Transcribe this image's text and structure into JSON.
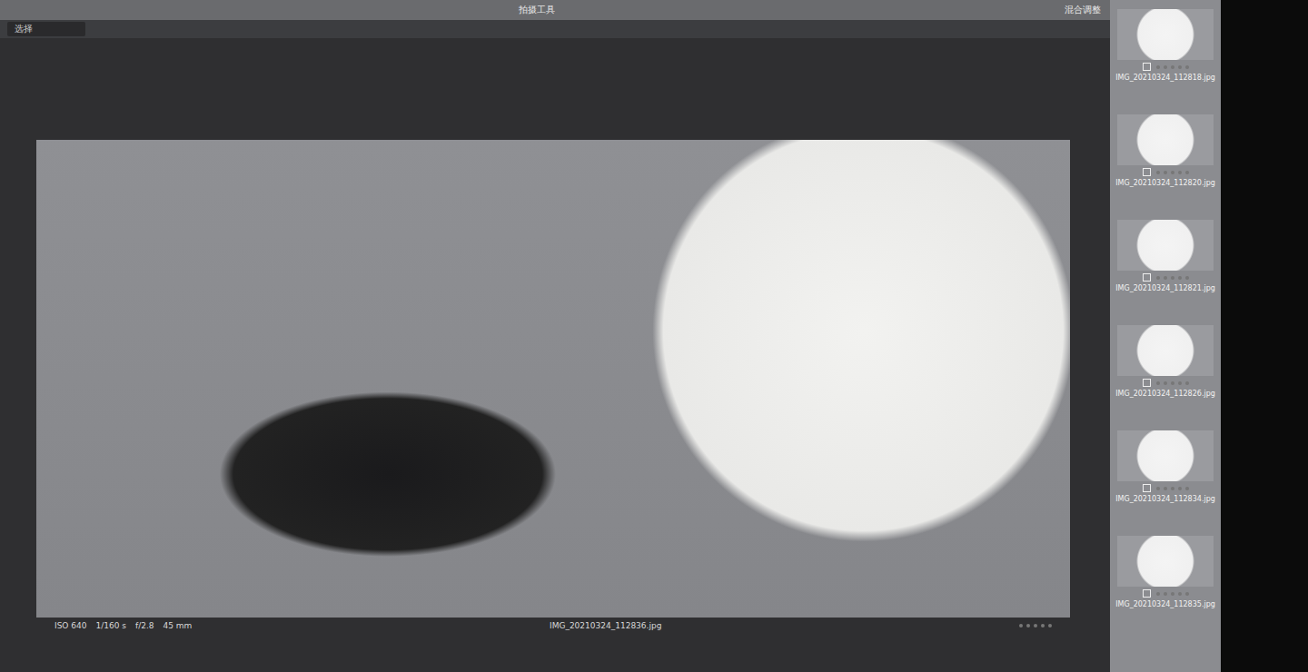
{
  "toolbar": {
    "title": "拍摄工具",
    "mode": "混合调整",
    "field": "选择"
  },
  "viewer": {
    "filename": "IMG_20210324_112836.jpg",
    "info": [
      "ISO 640",
      "1/160 s",
      "f/2.8",
      "45 mm"
    ],
    "stars": 0
  },
  "filmstrip": {
    "items": [
      {
        "filename": "IMG_20210324_112818.jpg",
        "stars": 0,
        "selected": false
      },
      {
        "filename": "IMG_20210324_112820.jpg",
        "stars": 0,
        "selected": false
      },
      {
        "filename": "IMG_20210324_112821.jpg",
        "stars": 0,
        "selected": false
      },
      {
        "filename": "IMG_20210324_112826.jpg",
        "stars": 0,
        "selected": false
      },
      {
        "filename": "IMG_20210324_112834.jpg",
        "stars": 0,
        "selected": false
      },
      {
        "filename": "IMG_20210324_112835.jpg",
        "stars": 0,
        "selected": false
      }
    ]
  }
}
